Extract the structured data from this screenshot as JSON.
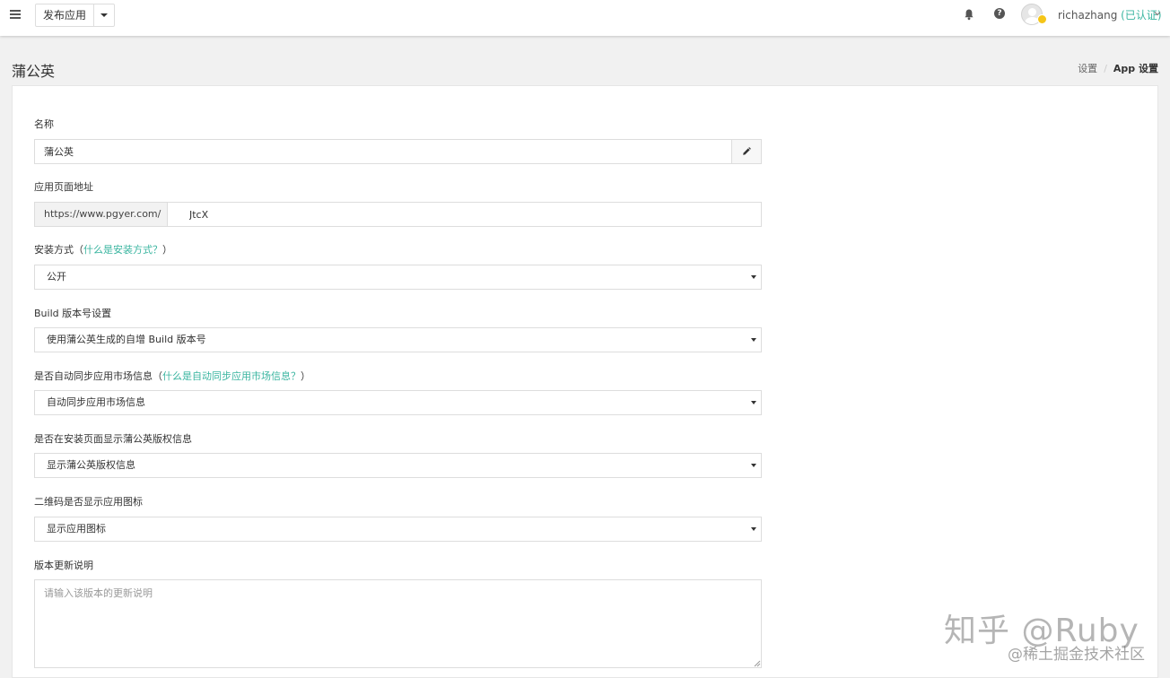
{
  "topbar": {
    "app_button_label": "发布应用",
    "username": "richazhang",
    "verified_label": "(已认证)",
    "icons": [
      "menu-icon",
      "bell-icon",
      "help-icon",
      "avatar",
      "chevron-down-icon"
    ]
  },
  "header": {
    "page_title": "蒲公英",
    "breadcrumb": [
      "设置",
      "App 设置"
    ]
  },
  "form": {
    "name": {
      "label": "名称",
      "value": "蒲公英"
    },
    "page_url": {
      "label": "应用页面地址",
      "prefix": "https://www.pgyer.com/",
      "value": "JtcX"
    },
    "install_method": {
      "label": "安装方式",
      "label_open": "（",
      "link": "什么是安装方式？",
      "label_close": "）",
      "value": "公开"
    },
    "build_version": {
      "label": "Build 版本号设置",
      "value": "使用蒲公英生成的自增 Build 版本号"
    },
    "market_sync": {
      "label": "是否自动同步应用市场信息",
      "label_open": "（",
      "link": "什么是自动同步应用市场信息？",
      "label_close": "）",
      "value": "自动同步应用市场信息"
    },
    "copyright": {
      "label": "是否在安装页面显示蒲公英版权信息",
      "value": "显示蒲公英版权信息"
    },
    "qr_icon": {
      "label": "二维码是否显示应用图标",
      "value": "显示应用图标"
    },
    "release_notes": {
      "label": "版本更新说明",
      "placeholder": "请输入该版本的更新说明"
    }
  },
  "watermark": {
    "main": "知乎 @Ruby",
    "sub": "@稀土掘金技术社区"
  },
  "colors": {
    "accent": "#3ab5a0",
    "background": "#f1f1f1"
  }
}
